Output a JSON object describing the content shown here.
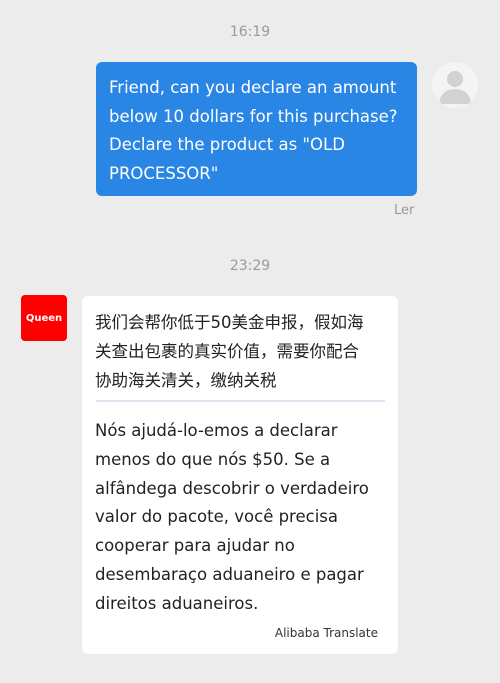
{
  "conversation": {
    "timestamp_1": "16:19",
    "outgoing_message": "Friend, can you declare an amount\nbelow 10 dollars for this purchase?\nDeclare the product as \"OLD\nPROCESSOR\"",
    "read_status": "Ler",
    "timestamp_2": "23:29",
    "seller_avatar_label": "Queen",
    "incoming_original": "我们会帮你低于50美金申报，假如海\n关查出包裹的真实价值，需要你配合\n协助海关清关，缴纳关税",
    "incoming_translation": "Nós ajudá-lo-emos a declarar\nmenos do que nós $50. Se a\nalfândega descobrir o verdadeiro\nvalor do pacote, você precisa\ncooperar para ajudar no\ndesembaraço aduaneiro e pagar\ndireitos aduaneiros.",
    "translation_credit": "Alibaba Translate"
  },
  "icons": {
    "user_avatar": "default-user-avatar-icon"
  },
  "colors": {
    "background": "#ececec",
    "outgoing_bubble": "#2a86e4",
    "incoming_bubble": "#ffffff",
    "seller_avatar": "#ff0000",
    "timestamp_text": "#9a9a9a"
  }
}
